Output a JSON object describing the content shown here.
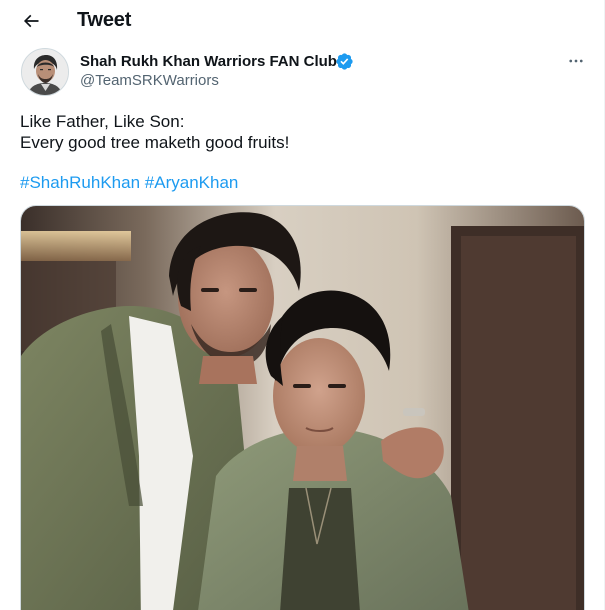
{
  "header": {
    "title": "Tweet"
  },
  "author": {
    "name": "Shah Rukh Khan Warriors FAN Club",
    "handle": "@TeamSRKWarriors",
    "verified": true
  },
  "tweet": {
    "lines": [
      "Like Father, Like Son:",
      "Every good tree maketh good fruits!"
    ],
    "hashtags": [
      "#ShahRuhKhan",
      "#AryanKhan"
    ]
  },
  "icons": {
    "back": "arrow-left-icon",
    "verified": "verified-badge-icon",
    "more": "more-horizontal-icon"
  },
  "colors": {
    "link": "#1d9bf0",
    "secondary_text": "#536471",
    "primary_text": "#0f1419",
    "verified": "#1d9bf0"
  }
}
